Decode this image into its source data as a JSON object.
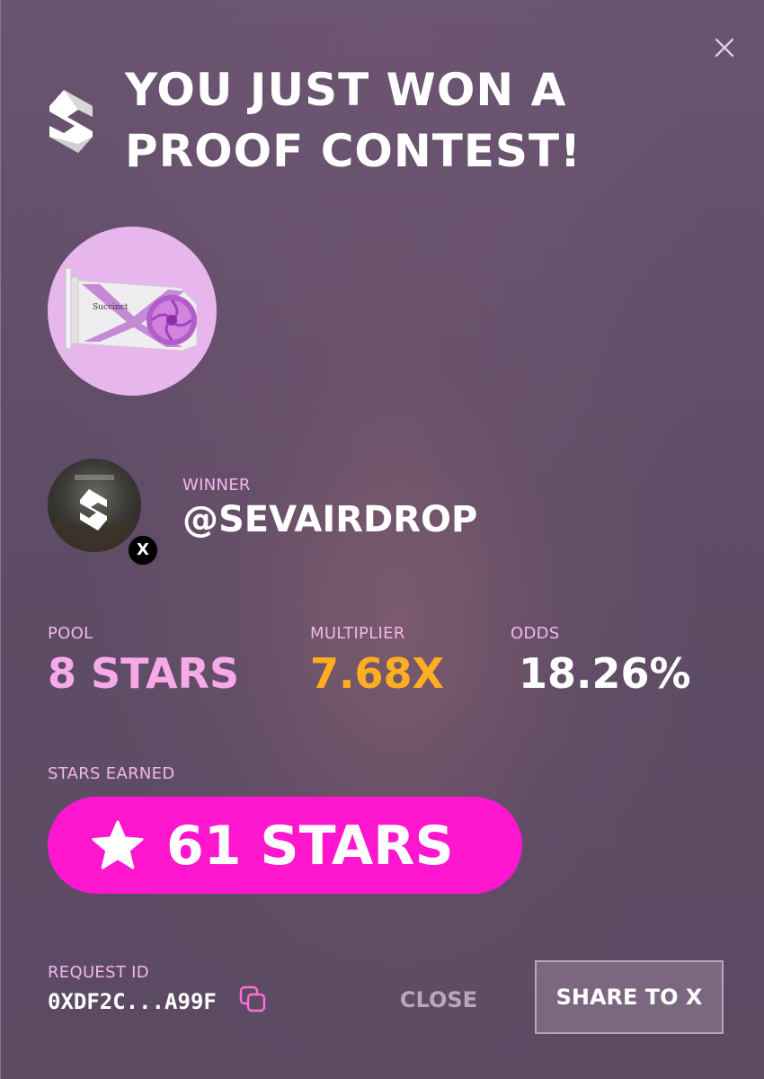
{
  "header": {
    "title": "YOU JUST WON A PROOF CONTEST!",
    "close_icon": "close-icon",
    "brand_icon": "succinct-logo-icon"
  },
  "prize": {
    "image": "gpu-graphics-card-image",
    "gpu_brand_text": "Succinct"
  },
  "winner": {
    "label": "WINNER",
    "handle": "@SEVAIRDROP",
    "platform_badge": "X",
    "avatar_icon": "succinct-logo-avatar"
  },
  "stats": {
    "pool": {
      "label": "POOL",
      "value": "8 STARS"
    },
    "multiplier": {
      "label": "MULTIPLIER",
      "value": "7.68X"
    },
    "odds": {
      "label": "ODDS",
      "value": "18.26%"
    }
  },
  "earned": {
    "label": "STARS EARNED",
    "value": "61 STARS",
    "icon": "star-icon"
  },
  "request": {
    "label": "REQUEST ID",
    "id": "0XDF2C...A99F",
    "copy_icon": "copy-icon"
  },
  "actions": {
    "close_label": "CLOSE",
    "share_label": "SHARE TO X"
  },
  "colors": {
    "background": "#5e4a63",
    "label_pink": "#f3b6ee",
    "pool_value": "#f7a9e8",
    "multiplier_value": "#ffae21",
    "odds_value": "#ffffff",
    "pill_magenta": "#ff16cf",
    "prize_circle": "#e6b6ec"
  }
}
